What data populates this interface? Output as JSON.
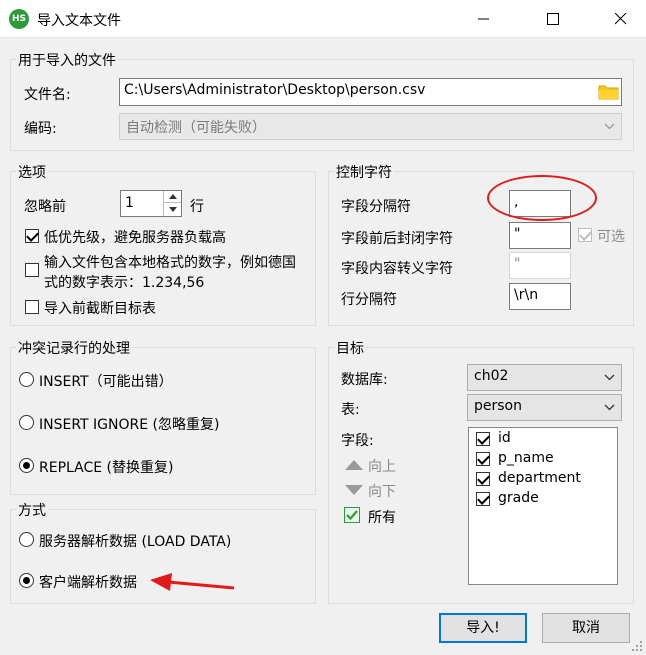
{
  "window": {
    "title": "导入文本文件",
    "app_icon_text": "HS"
  },
  "file_group": {
    "title": "用于导入的文件",
    "filename_label": "文件名:",
    "filename_value": "C:\\Users\\Administrator\\Desktop\\person.csv",
    "encoding_label": "编码:",
    "encoding_value": "自动检测（可能失败）"
  },
  "options": {
    "title": "选项",
    "skip_label": "忽略前",
    "skip_value": "1",
    "skip_unit": "行",
    "low_priority_label": "低优先级，避免服务器负载高",
    "low_priority_checked": true,
    "locale_numbers_line1": "输入文件包含本地格式的数字，例如德国",
    "locale_numbers_line2": "式的数字表示：1.234,56",
    "locale_numbers_checked": false,
    "truncate_label": "导入前截断目标表",
    "truncate_checked": false
  },
  "control_chars": {
    "title": "控制字符",
    "field_sep_label": "字段分隔符",
    "field_sep_value": ",",
    "enclose_label": "字段前后封闭字符",
    "enclose_value": "\"",
    "optional_label": "可选",
    "escape_label": "字段内容转义字符",
    "escape_value": "\"",
    "line_sep_label": "行分隔符",
    "line_sep_value": "\\r\\n"
  },
  "conflict": {
    "title": "冲突记录行的处理",
    "options": [
      {
        "label": "INSERT（可能出错）",
        "selected": false
      },
      {
        "label": "INSERT IGNORE (忽略重复)",
        "selected": false
      },
      {
        "label": "REPLACE (替换重复)",
        "selected": true
      }
    ]
  },
  "method": {
    "title": "方式",
    "options": [
      {
        "label": "服务器解析数据 (LOAD DATA)",
        "selected": false
      },
      {
        "label": "客户端解析数据",
        "selected": true
      }
    ]
  },
  "target": {
    "title": "目标",
    "database_label": "数据库:",
    "database_value": "ch02",
    "table_label": "表:",
    "table_value": "person",
    "fields_label": "字段:",
    "up_label": "向上",
    "down_label": "向下",
    "all_label": "所有",
    "fields": [
      {
        "name": "id",
        "checked": true
      },
      {
        "name": "p_name",
        "checked": true
      },
      {
        "name": "department",
        "checked": true
      },
      {
        "name": "grade",
        "checked": true
      }
    ]
  },
  "buttons": {
    "import_label": "导入!",
    "cancel_label": "取消"
  },
  "colors": {
    "annotation_red": "#e11a1a",
    "focus_blue": "#0078d7"
  }
}
